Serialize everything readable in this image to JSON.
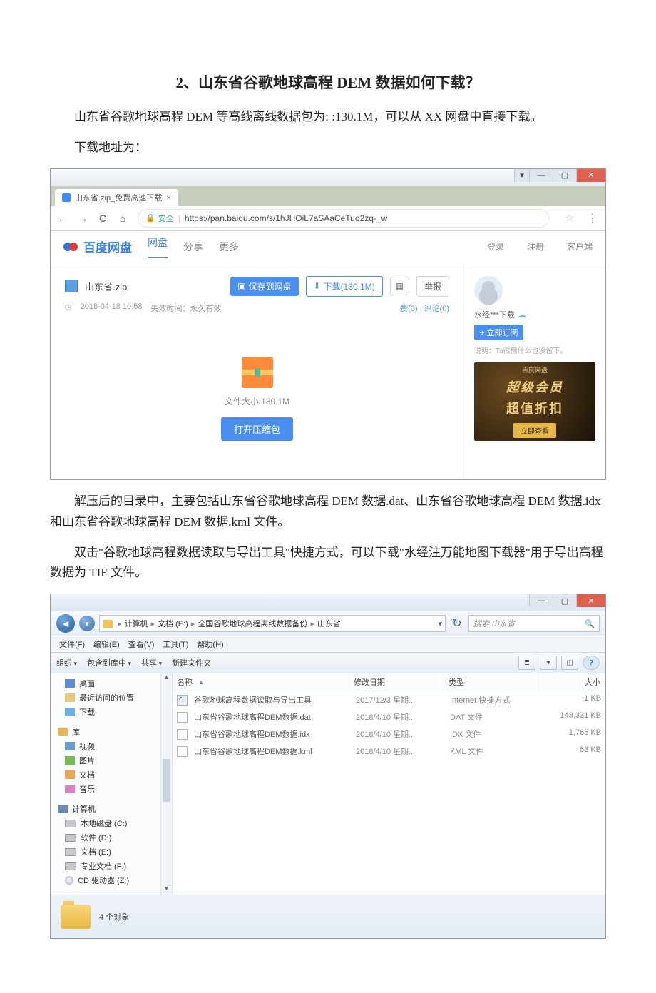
{
  "heading": "2、山东省谷歌地球高程 DEM 数据如何下载？",
  "para1": "山东省谷歌地球高程 DEM 等高线离线数据包为: :130.1M，可以从 XX 网盘中直接下载。",
  "para2": "下载地址为：",
  "para3": "解压后的目录中，主要包括山东省谷歌地球高程 DEM 数据.dat、山东省谷歌地球高程 DEM 数据.idx 和山东省谷歌地球高程 DEM 数据.kml 文件。",
  "para4": "双击\"谷歌地球高程数据读取与导出工具\"快捷方式，可以下载\"水经注万能地图下载器\"用于导出高程数据为 TIF 文件。",
  "browser": {
    "tab_title": "山东省.zip_免费高速下载",
    "secure_label": "安全",
    "url": "https://pan.baidu.com/s/1hJHOiL7aSAaCeTuo2zq-_w",
    "brand": "百度网盘",
    "nav1": "网盘",
    "nav2": "分享",
    "nav3": "更多",
    "login": "登录",
    "register": "注册",
    "client": "客户端",
    "file_name": "山东省.zip",
    "btn_save": "保存到网盘",
    "btn_download": "下载(130.1M)",
    "btn_report": "举报",
    "meta_time": "2018-04-18 10:58",
    "meta_expire": "失效时间：永久有效",
    "like": "赞(0)",
    "comment": "评论(0)",
    "filesize": "文件大小:130.1M",
    "btn_open": "打开压缩包",
    "side_name": "水经***下载",
    "side_sub": "+ 立即订阅",
    "side_desc": "说明：Ta很懒什么也没留下。",
    "promo1": "百度网盘",
    "promo2": "超级会员",
    "promo3": "超值折扣",
    "promo_cta": "立即查看"
  },
  "explorer": {
    "crumbs": [
      "计算机",
      "文档 (E:)",
      "全国谷歌地球高程离线数据备份",
      "山东省"
    ],
    "search_ph": "搜索 山东省",
    "menus": [
      "文件(F)",
      "编辑(E)",
      "查看(V)",
      "工具(T)",
      "帮助(H)"
    ],
    "tools": {
      "org": "组织",
      "inc": "包含到库中",
      "share": "共享",
      "new": "新建文件夹"
    },
    "cols": {
      "name": "名称",
      "date": "修改日期",
      "type": "类型",
      "size": "大小"
    },
    "files": [
      {
        "n": "谷歌地球高程数据读取与导出工具",
        "d": "2017/12/3 星期...",
        "t": "Internet 快捷方式",
        "s": "1 KB",
        "ico": "shortcut"
      },
      {
        "n": "山东省谷歌地球高程DEM数据.dat",
        "d": "2018/4/10 星期...",
        "t": "DAT 文件",
        "s": "148,331 KB",
        "ico": "generic"
      },
      {
        "n": "山东省谷歌地球高程DEM数据.idx",
        "d": "2018/4/10 星期...",
        "t": "IDX 文件",
        "s": "1,765 KB",
        "ico": "generic"
      },
      {
        "n": "山东省谷歌地球高程DEM数据.kml",
        "d": "2018/4/10 星期...",
        "t": "KML 文件",
        "s": "53 KB",
        "ico": "generic"
      }
    ],
    "sidebar": {
      "desktop": "桌面",
      "recent": "最近访问的位置",
      "dl": "下载",
      "lib": "库",
      "vid": "视频",
      "pic": "图片",
      "doc": "文档",
      "mus": "音乐",
      "comp": "计算机",
      "c": "本地磁盘 (C:)",
      "d": "软件 (D:)",
      "e": "文档 (E:)",
      "f": "专业文档 (F:)",
      "z": "CD 驱动器 (Z:)"
    },
    "status": "4 个对象"
  }
}
